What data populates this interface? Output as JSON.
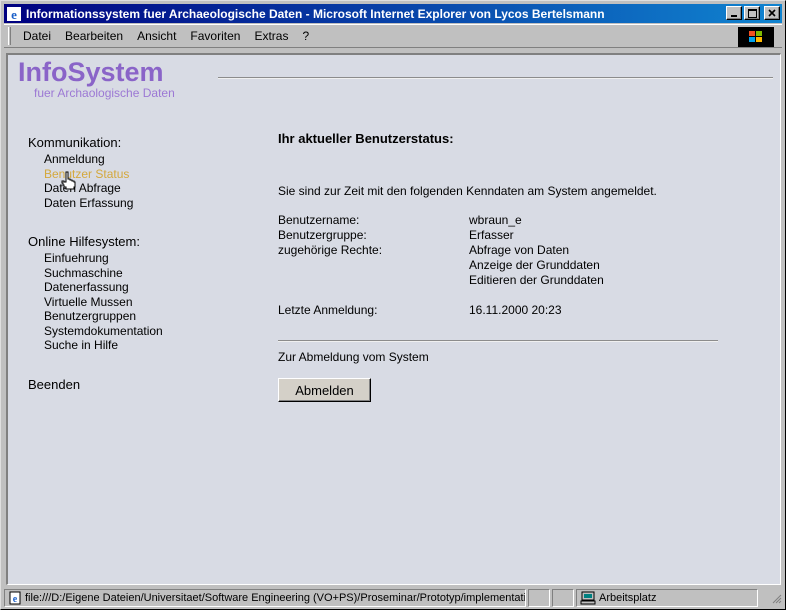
{
  "window": {
    "title": "Informationssystem fuer Archaeologische Daten - Microsoft Internet Explorer von Lycos Bertelsmann",
    "app_icon": "ie-icon",
    "controls": {
      "minimize": "_",
      "maximize": "□",
      "close": "×"
    }
  },
  "menubar": {
    "items": [
      "Datei",
      "Bearbeiten",
      "Ansicht",
      "Favoriten",
      "Extras",
      "?"
    ]
  },
  "logo": {
    "brand": "InfoSystem",
    "subtitle": "fuer Archaologische Daten"
  },
  "nav": {
    "communication_title": "Kommunikation:",
    "communication_links": [
      "Anmeldung",
      "Benutzer Status",
      "Daten Abfrage",
      "Daten Erfassung"
    ],
    "active_link": "Benutzer Status",
    "help_title": "Online Hilfesystem:",
    "help_links": [
      "Einfuehrung",
      "Suchmaschine",
      "Datenerfassung",
      "Virtuelle Mussen",
      "Benutzergruppen",
      "Systemdokumentation",
      "Suche in Hilfe"
    ],
    "exit": "Beenden"
  },
  "main": {
    "heading": "Ihr aktueller Benutzerstatus:",
    "intro": "Sie sind zur Zeit mit den folgenden Kenndaten am System angemeldet.",
    "username_label": "Benutzername:",
    "username_value": "wbraun_e",
    "group_label": "Benutzergruppe:",
    "group_value": "Erfasser",
    "rights_label": "zugehörige Rechte:",
    "rights": [
      "Abfrage von Daten",
      "Anzeige der Grunddaten",
      "Editieren der Grunddaten"
    ],
    "last_login_label": "Letzte Anmeldung:",
    "last_login_value": "16.11.2000 20:23",
    "logout_text": "Zur Abmeldung vom System",
    "logout_button": "Abmelden"
  },
  "statusbar": {
    "url": "file:///D:/Eigene Dateien/Universitaet/Software Engineering (VO+PS)/Proseminar/Prototyp/implementatio",
    "zone": "Arbeitsplatz"
  },
  "colors": {
    "title_gradient_start": "#000080",
    "title_gradient_end": "#1084d0",
    "brand": "#8a64c8",
    "active_link": "#d4a83c",
    "content_bg": "#d8dbe4"
  }
}
